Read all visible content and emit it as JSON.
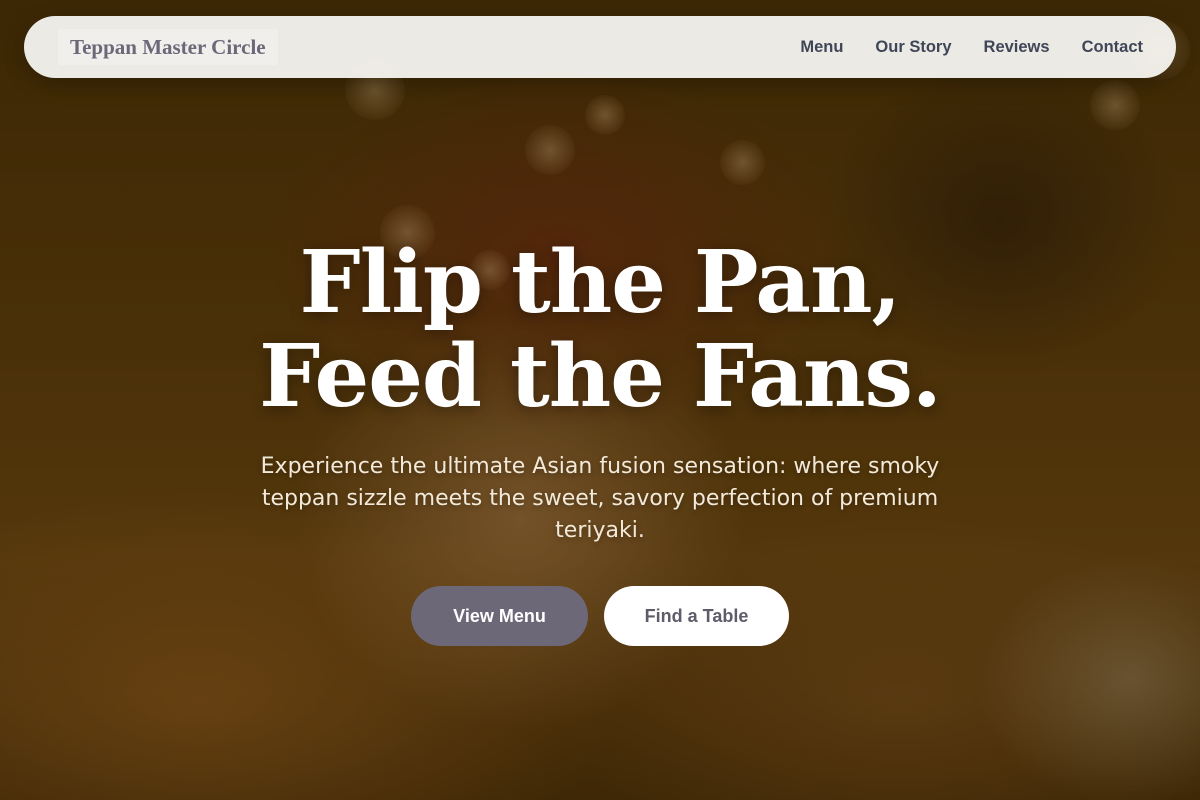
{
  "brand": {
    "name": "Teppan Master Circle"
  },
  "nav": {
    "items": [
      {
        "label": "Menu"
      },
      {
        "label": "Our Story"
      },
      {
        "label": "Reviews"
      },
      {
        "label": "Contact"
      }
    ]
  },
  "hero": {
    "headline_line1": "Flip the Pan,",
    "headline_line2": "Feed the Fans.",
    "subtext": "Experience the ultimate Asian fusion sensation: where smoky teppan sizzle meets the sweet, savory perfection of premium teriyaki.",
    "primary_button": "View Menu",
    "secondary_button": "Find a Table"
  },
  "colors": {
    "navbar_bg": "#f8f6f2",
    "brand_text": "#6b6878",
    "nav_text": "#3f4658",
    "primary_button_bg": "#6c6877",
    "secondary_button_bg": "#ffffff",
    "headline": "#ffffff"
  }
}
